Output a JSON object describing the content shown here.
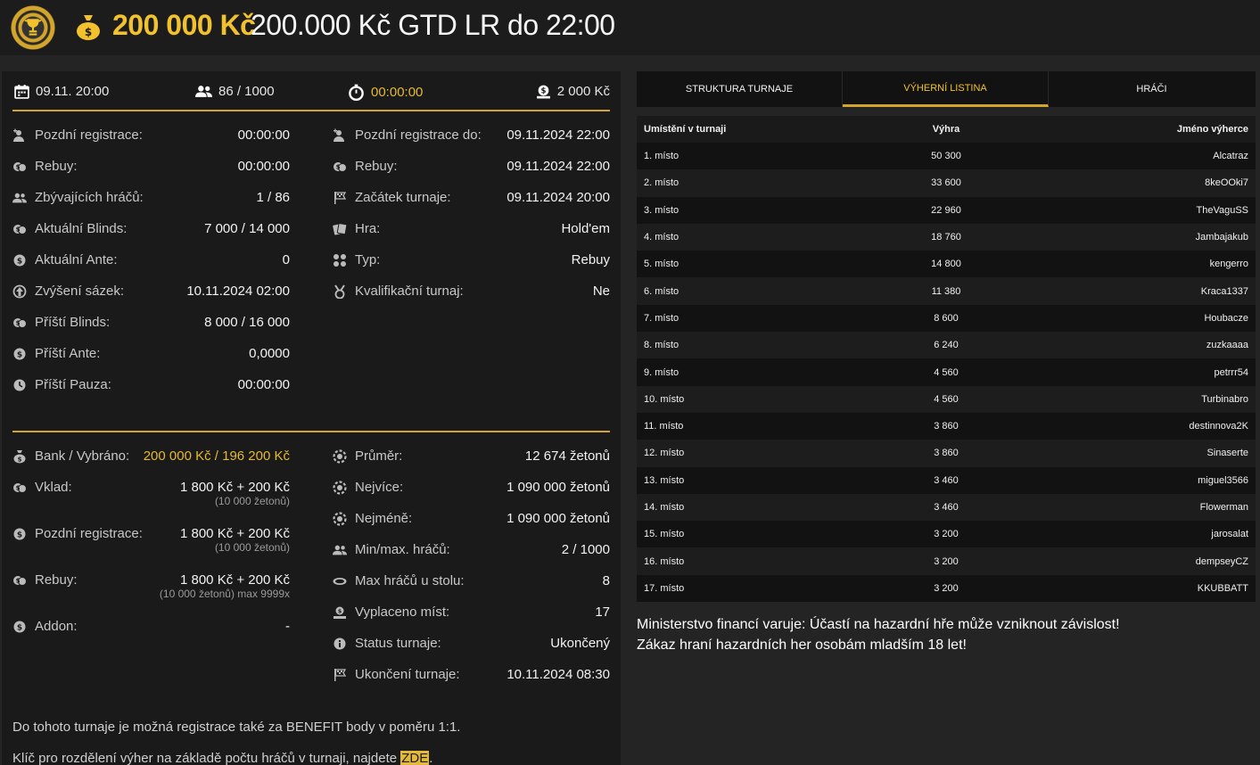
{
  "header": {
    "amount": "200 000 Kč",
    "name": "200.000 Kč GTD LR do 22:00"
  },
  "summary": {
    "date": "09.11. 20:00",
    "players": "86 / 1000",
    "timer": "00:00:00",
    "buyin": "2 000 Kč"
  },
  "info_left": [
    {
      "label": "Pozdní registrace:",
      "value": "00:00:00",
      "icon": "user-plus-icon"
    },
    {
      "label": "Rebuy:",
      "value": "00:00:00",
      "icon": "coins-icon"
    },
    {
      "label": "Zbývajících hráčů:",
      "value": "1 / 86",
      "icon": "users-icon"
    },
    {
      "label": "Aktuální Blinds:",
      "value": "7 000 / 14 000",
      "icon": "coins-icon"
    },
    {
      "label": "Aktuální Ante:",
      "value": "0",
      "icon": "dollar-coin-icon"
    },
    {
      "label": "Zvýšení sázek:",
      "value": "10.11.2024 02:00",
      "icon": "arrow-up-circle-icon"
    },
    {
      "label": "Příští Blinds:",
      "value": "8 000 / 16 000",
      "icon": "coins-icon"
    },
    {
      "label": "Příští Ante:",
      "value": "0,0000",
      "icon": "dollar-coin-icon"
    },
    {
      "label": "Příští Pauza:",
      "value": "00:00:00",
      "icon": "clock-icon"
    }
  ],
  "info_right": [
    {
      "label": "Pozdní registrace do:",
      "value": "09.11.2024 22:00",
      "icon": "user-plus-icon"
    },
    {
      "label": "Rebuy:",
      "value": "09.11.2024 22:00",
      "icon": "coins-icon"
    },
    {
      "label": "Začátek turnaje:",
      "value": "09.11.2024 20:00",
      "icon": "flag-icon"
    },
    {
      "label": "Hra:",
      "value": "Hold'em",
      "icon": "cards-icon"
    },
    {
      "label": "Typ:",
      "value": "Rebuy",
      "icon": "clubs-icon"
    },
    {
      "label": "Kvalifikační turnaj:",
      "value": "Ne",
      "icon": "medal-icon"
    }
  ],
  "finance_left": [
    {
      "label": "Bank / Vybráno:",
      "value": "200 000 Kč / 196 200 Kč",
      "sub": "",
      "icon": "moneybag-icon"
    },
    {
      "label": "Vklad:",
      "value": "1 800 Kč + 200 Kč",
      "sub": "(10 000 žetonů)",
      "icon": "coins-icon"
    },
    {
      "label": "Pozdní registrace:",
      "value": "1 800 Kč + 200 Kč",
      "sub": "(10 000 žetonů)",
      "icon": "dollar-coin-icon"
    },
    {
      "label": "Rebuy:",
      "value": "1 800 Kč + 200 Kč",
      "sub": "(10 000 žetonů) max 9999x",
      "icon": "coins-icon"
    },
    {
      "label": "Addon:",
      "value": "-",
      "sub": "",
      "icon": "dollar-coin-icon"
    }
  ],
  "finance_right": [
    {
      "label": "Průměr:",
      "value": "12 674 žetonů",
      "icon": "chip-icon"
    },
    {
      "label": "Nejvíce:",
      "value": "1 090 000 žetonů",
      "icon": "chip-icon"
    },
    {
      "label": "Nejméně:",
      "value": "1 090 000 žetonů",
      "icon": "chip-icon"
    },
    {
      "label": "Min/max. hráčů:",
      "value": "2 / 1000",
      "icon": "users-icon"
    },
    {
      "label": "Max hráčů u stolu:",
      "value": "8",
      "icon": "table-icon"
    },
    {
      "label": "Vyplaceno míst:",
      "value": "17",
      "icon": "payout-icon"
    },
    {
      "label": "Status turnaje:",
      "value": "Ukončený",
      "icon": "info-icon"
    },
    {
      "label": "Ukončení turnaje:",
      "value": "10.11.2024 08:30",
      "icon": "flag-icon"
    }
  ],
  "notes": {
    "benefit": "Do tohoto turnaje je možná registrace také za BENEFIT body v poměru 1:1.",
    "key_text": "Klíč pro rozdělení výher na základě počtu hráčů v turnaji, najdete ",
    "key_link": "ZDE",
    "key_end": "."
  },
  "tabs": [
    "STRUKTURA TURNAJE",
    "VÝHERNÍ LISTINA",
    "HRÁČI"
  ],
  "table": {
    "headers": [
      "Umístění v turnaji",
      "Výhra",
      "Jméno výherce"
    ],
    "rows": [
      [
        "1. místo",
        "50 300",
        "Alcatraz"
      ],
      [
        "2. místo",
        "33 600",
        "8keOOki7"
      ],
      [
        "3. místo",
        "22 960",
        "TheVaguSS"
      ],
      [
        "4. místo",
        "18 760",
        "Jambajakub"
      ],
      [
        "5. místo",
        "14 800",
        "kengerro"
      ],
      [
        "6. místo",
        "11 380",
        "Kraca1337"
      ],
      [
        "7. místo",
        "8 600",
        "Houbacze"
      ],
      [
        "8. místo",
        "6 240",
        "zuzkaaaa"
      ],
      [
        "9. místo",
        "4 560",
        "petrrr54"
      ],
      [
        "10. místo",
        "4 560",
        "Turbinabro"
      ],
      [
        "11. místo",
        "3 860",
        "destinnova2K"
      ],
      [
        "12. místo",
        "3 860",
        "Sinaserte"
      ],
      [
        "13. místo",
        "3 460",
        "miguel3566"
      ],
      [
        "14. místo",
        "3 460",
        "Flowerman"
      ],
      [
        "15. místo",
        "3 200",
        "jarosalat"
      ],
      [
        "16. místo",
        "3 200",
        "dempseyCZ"
      ],
      [
        "17. místo",
        "3 200",
        "KKUBBATT"
      ]
    ]
  },
  "warning": [
    "Ministerstvo financí varuje: Účastí na hazardní hře může vzniknout závislost!",
    "Zákaz hraní hazardních her osobám mladším 18 let!"
  ],
  "colors": {
    "accent": "#d4a52b",
    "gold_text": "#f2c12e",
    "panel": "#1a1a1a",
    "background": "#242424"
  }
}
